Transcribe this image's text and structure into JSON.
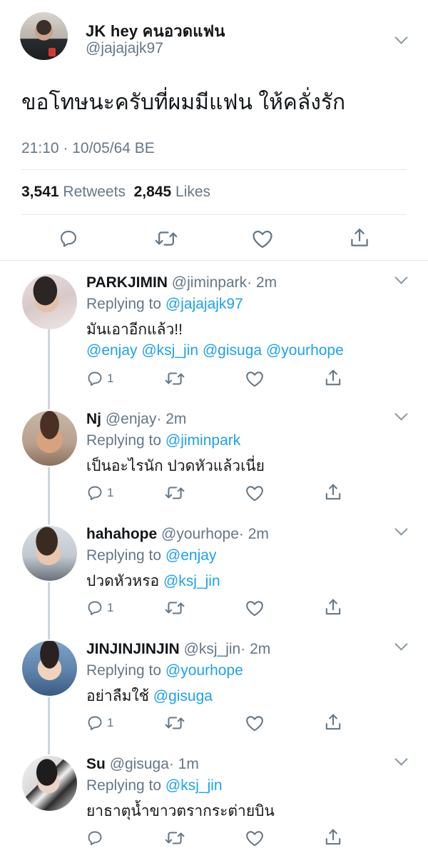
{
  "tweet": {
    "display_name": "JK hey คนอวดแฟน",
    "handle": "@jajajajk97",
    "text": "ขอโทษนะครับที่ผมมีแฟน ให้คลั่งรัก",
    "timestamp": "21:10 · 10/05/64 BE",
    "retweet_count": "3,541",
    "retweet_label": "Retweets",
    "like_count": "2,845",
    "like_label": "Likes"
  },
  "replies": [
    {
      "name": "PARKJIMIN",
      "handle": "@jiminpark",
      "time": "· 2m",
      "replying_label": "Replying to",
      "replying_to": "@jajajajk97",
      "body": "มันเอาอีกแล้ว!!",
      "body_mention": "",
      "mentions": "@enjay @ksj_jin @gisuga @yourhope",
      "reply_count": "1"
    },
    {
      "name": "Nj",
      "handle": "@enjay",
      "time": "· 2m",
      "replying_label": "Replying to",
      "replying_to": "@jiminpark",
      "body": "เป็นอะไรนัก ปวดหัวแล้วเนี่ย",
      "body_mention": "",
      "mentions": "",
      "reply_count": "1"
    },
    {
      "name": "hahahope",
      "handle": "@yourhope",
      "time": "· 2m",
      "replying_label": "Replying to",
      "replying_to": "@enjay",
      "body": "ปวดหัวหรอ ",
      "body_mention": "@ksj_jin",
      "mentions": "",
      "reply_count": "1"
    },
    {
      "name": "JINJINJINJIN",
      "handle": "@ksj_jin",
      "time": "· 2m",
      "replying_label": "Replying to",
      "replying_to": "@yourhope",
      "body": "อย่าลืมใช้ ",
      "body_mention": "@gisuga",
      "mentions": "",
      "reply_count": "1"
    },
    {
      "name": "Su",
      "handle": "@gisuga",
      "time": "· 1m",
      "replying_label": "Replying to",
      "replying_to": "@ksj_jin",
      "body": "ยาธาตุน้ำขาวตรากระต่ายบิน",
      "body_mention": "",
      "mentions": "",
      "reply_count": ""
    }
  ],
  "icons": {
    "reply": "reply-icon",
    "retweet": "retweet-icon",
    "like": "like-icon",
    "share": "share-icon",
    "more": "chevron-down-icon"
  },
  "colors": {
    "link": "#1da1f2",
    "secondary_text": "#657786",
    "divider": "#e1e8ed",
    "thread_line": "#ccd6dd"
  }
}
